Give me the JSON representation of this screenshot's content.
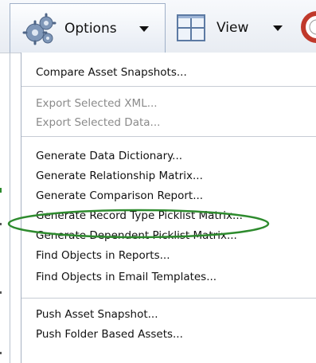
{
  "toolbar": {
    "options_label": "Options",
    "view_label": "View",
    "icons": [
      "gear-cluster-icon",
      "window-grid-icon",
      "life-ring-icon"
    ]
  },
  "menu": {
    "groups": [
      {
        "items": [
          {
            "label": "Compare Asset Snapshots...",
            "enabled": true
          }
        ]
      },
      {
        "items": [
          {
            "label": "Export Selected XML...",
            "enabled": false
          },
          {
            "label": "Export Selected Data...",
            "enabled": false
          }
        ]
      },
      {
        "items": [
          {
            "label": "Generate Data Dictionary...",
            "enabled": true
          },
          {
            "label": "Generate Relationship Matrix...",
            "enabled": true
          },
          {
            "label": "Generate Comparison Report...",
            "enabled": true
          },
          {
            "label": "Generate Record Type Picklist Matrix...",
            "enabled": true
          },
          {
            "label": "Generate Dependent Picklist Matrix...",
            "enabled": true
          },
          {
            "label": "Find Objects in Reports...",
            "enabled": true
          },
          {
            "label": "Find Objects in Email Templates...",
            "enabled": true,
            "highlighted": true
          }
        ]
      },
      {
        "items": [
          {
            "label": "Push Asset Snapshot...",
            "enabled": true
          },
          {
            "label": "Push Folder Based Assets...",
            "enabled": true
          }
        ]
      }
    ]
  },
  "colors": {
    "text": "#111111",
    "disabled_text": "#8a8a8a",
    "highlight_ellipse": "#2e8b2e",
    "separator": "#c7ccd4"
  }
}
